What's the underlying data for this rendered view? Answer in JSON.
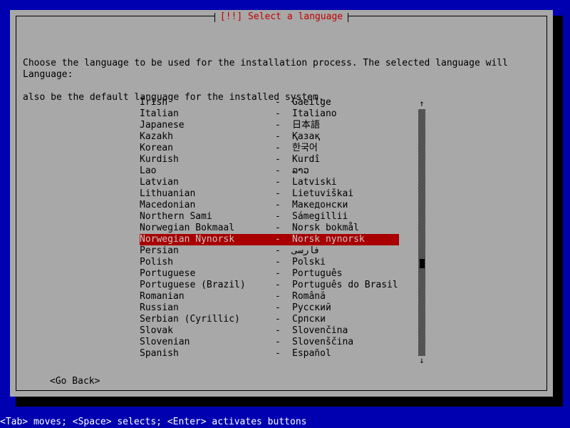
{
  "screen": {
    "background_color": "#0000b0",
    "dialog_background_color": "#a8a8a8",
    "title_color": "#c00000",
    "selection_background_color": "#a80000",
    "selection_text_color": "#c8c8c8",
    "help_bar_color": "#0000b0"
  },
  "dialog": {
    "title": "[!!] Select a language",
    "body_line1": "Choose the language to be used for the installation process. The selected language will",
    "body_line2": "also be the default language for the installed system.",
    "field_label": "Language:"
  },
  "language_list": {
    "column_separator": "-",
    "selected_index": 12,
    "items": [
      {
        "english": "Irish",
        "native": "Gaeilge"
      },
      {
        "english": "Italian",
        "native": "Italiano"
      },
      {
        "english": "Japanese",
        "native": "日本語"
      },
      {
        "english": "Kazakh",
        "native": "Қазақ"
      },
      {
        "english": "Korean",
        "native": "한국어"
      },
      {
        "english": "Kurdish",
        "native": "Kurdî"
      },
      {
        "english": "Lao",
        "native": "ລາວ"
      },
      {
        "english": "Latvian",
        "native": "Latviski"
      },
      {
        "english": "Lithuanian",
        "native": "Lietuviškai"
      },
      {
        "english": "Macedonian",
        "native": "Македонски"
      },
      {
        "english": "Northern Sami",
        "native": "Sámegillii"
      },
      {
        "english": "Norwegian Bokmaal",
        "native": "Norsk bokmål"
      },
      {
        "english": "Norwegian Nynorsk",
        "native": "Norsk nynorsk"
      },
      {
        "english": "Persian",
        "native": "فارسی"
      },
      {
        "english": "Polish",
        "native": "Polski"
      },
      {
        "english": "Portuguese",
        "native": "Português"
      },
      {
        "english": "Portuguese (Brazil)",
        "native": "Português do Brasil"
      },
      {
        "english": "Romanian",
        "native": "Română"
      },
      {
        "english": "Russian",
        "native": "Русский"
      },
      {
        "english": "Serbian (Cyrillic)",
        "native": "Српски"
      },
      {
        "english": "Slovak",
        "native": "Slovenčina"
      },
      {
        "english": "Slovenian",
        "native": "Slovenščina"
      },
      {
        "english": "Spanish",
        "native": "Español"
      }
    ]
  },
  "scrollbar": {
    "up_arrow": "↑",
    "down_arrow": "↓",
    "thumb_position_percent": 63
  },
  "buttons": {
    "go_back": "<Go Back>"
  },
  "help_bar": {
    "text": "<Tab> moves; <Space> selects; <Enter> activates buttons"
  }
}
